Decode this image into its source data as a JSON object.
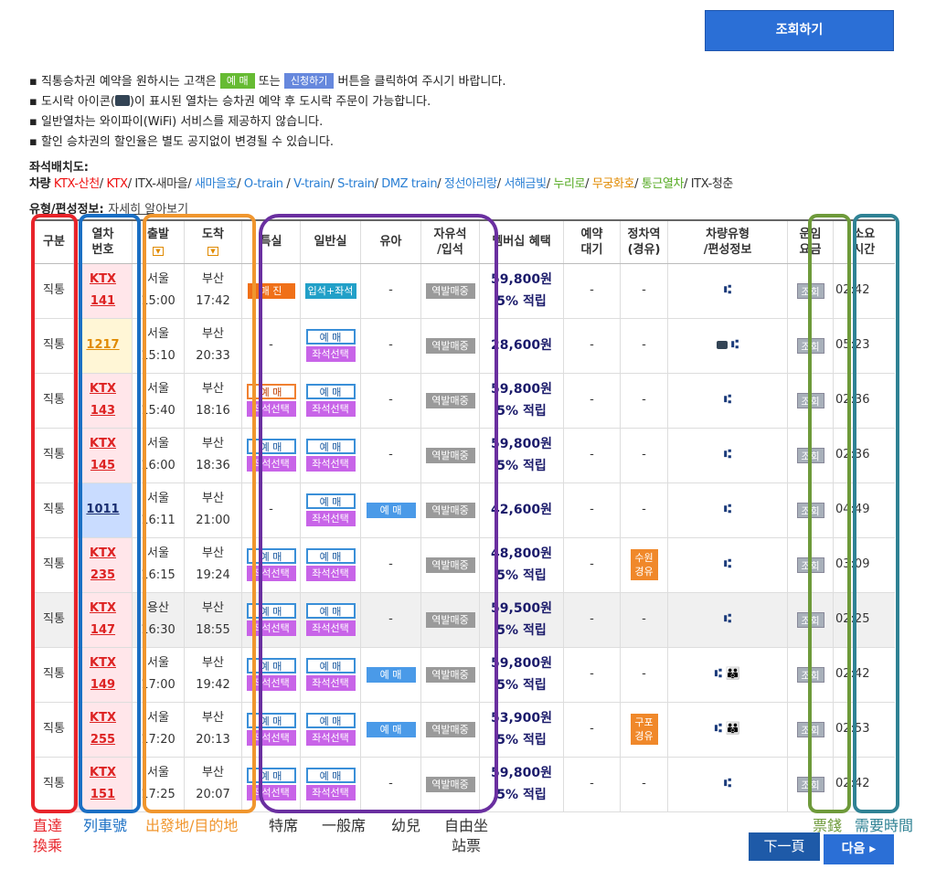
{
  "search_button": "조회하기",
  "notices": {
    "n1_a": "직통승차권 예약을 원하시는 고객은",
    "n1_chip1": "예 매",
    "n1_b": "또는",
    "n1_chip2": "신청하기",
    "n1_c": "버튼을 클릭하여 주시기 바랍니다.",
    "n2_a": "도시락 아이콘(",
    "n2_b": ")이 표시된 열차는 승차권 예약 후 도시락 주문이 가능합니다.",
    "n3": "일반열차는 와이파이(WiFi) 서비스를 제공하지 않습니다.",
    "n4": "할인 승차권의 할인율은 별도 공지없이 변경될 수 있습니다."
  },
  "seat_layout_label": "좌석배치도:",
  "vehicle_label": "차량",
  "types": [
    "KTX-산천",
    "KTX",
    "ITX-새마을",
    "새마을호",
    "O-train",
    "V-train",
    "S-train",
    "DMZ train",
    "정선아리랑",
    "서해금빛",
    "누리로",
    "무궁화호",
    "통근열차",
    "ITX-청춘"
  ],
  "composition_label": "유형/편성정보:",
  "composition_link": "자세히 알아보기",
  "headers": {
    "type": "구분",
    "train_no": "열차\n번호",
    "dep": "출발",
    "arr": "도착",
    "special": "특실",
    "general": "일반실",
    "infant": "유아",
    "free": "자유석\n/입석",
    "member": "멤버십 혜택",
    "wait": "예약\n대기",
    "stops": "정차역\n(경유)",
    "car": "차량유형\n/편성정보",
    "fare": "운임\n요금",
    "duration": "소요\n시간"
  },
  "labels": {
    "reserve": "예 매",
    "seat_select": "좌석선택",
    "sold_out": "매 진",
    "standing_seat": "입석+좌석",
    "station_sale": "역발매중",
    "lookup": "조회",
    "points": "5% 적립",
    "dash": "-"
  },
  "rows": [
    {
      "type": "직통",
      "brand": "KTX",
      "no": "141",
      "dep": "서울",
      "dep_t": "15:00",
      "arr": "부산",
      "arr_t": "17:42",
      "special": "sold",
      "general": "standseat",
      "infant": "-",
      "price": "59,800원",
      "pts": true,
      "via": "",
      "icons": "seat",
      "dur": "02:42",
      "bg": "pink"
    },
    {
      "type": "직통",
      "brand": "",
      "no": "1217",
      "dep": "서울",
      "dep_t": "15:10",
      "arr": "부산",
      "arr_t": "20:33",
      "special": "-",
      "general": "res",
      "infant": "-",
      "price": "28,600원",
      "pts": false,
      "via": "",
      "icons": "lunch",
      "dur": "05:23",
      "bg": "yellow"
    },
    {
      "type": "직통",
      "brand": "KTX",
      "no": "143",
      "dep": "서울",
      "dep_t": "15:40",
      "arr": "부산",
      "arr_t": "18:16",
      "special": "reso",
      "general": "res",
      "infant": "-",
      "price": "59,800원",
      "pts": true,
      "via": "",
      "icons": "seat",
      "dur": "02:36",
      "bg": "pink"
    },
    {
      "type": "직통",
      "brand": "KTX",
      "no": "145",
      "dep": "서울",
      "dep_t": "16:00",
      "arr": "부산",
      "arr_t": "18:36",
      "special": "res",
      "general": "res",
      "infant": "-",
      "price": "59,800원",
      "pts": true,
      "via": "",
      "icons": "seat",
      "dur": "02:36",
      "bg": "pink"
    },
    {
      "type": "직통",
      "brand": "",
      "no": "1011",
      "dep": "서울",
      "dep_t": "16:11",
      "arr": "부산",
      "arr_t": "21:00",
      "special": "-",
      "general": "res",
      "infant": "baby",
      "price": "42,600원",
      "pts": false,
      "via": "",
      "icons": "seat",
      "dur": "04:49",
      "bg": "blue"
    },
    {
      "type": "직통",
      "brand": "KTX",
      "no": "235",
      "dep": "서울",
      "dep_t": "16:15",
      "arr": "부산",
      "arr_t": "19:24",
      "special": "res",
      "general": "res",
      "infant": "-",
      "price": "48,800원",
      "pts": true,
      "via": "수원\n경유",
      "icons": "seat",
      "dur": "03:09",
      "bg": "pink"
    },
    {
      "type": "직통",
      "brand": "KTX",
      "no": "147",
      "dep": "용산",
      "dep_t": "16:30",
      "arr": "부산",
      "arr_t": "18:55",
      "special": "res",
      "general": "res",
      "infant": "-",
      "price": "59,500원",
      "pts": true,
      "via": "",
      "icons": "seat",
      "dur": "02:25",
      "bg": "pink",
      "shade": true
    },
    {
      "type": "직통",
      "brand": "KTX",
      "no": "149",
      "dep": "서울",
      "dep_t": "17:00",
      "arr": "부산",
      "arr_t": "19:42",
      "special": "res",
      "general": "res",
      "infant": "baby",
      "price": "59,800원",
      "pts": true,
      "via": "",
      "icons": "family",
      "dur": "02:42",
      "bg": "pink"
    },
    {
      "type": "직통",
      "brand": "KTX",
      "no": "255",
      "dep": "서울",
      "dep_t": "17:20",
      "arr": "부산",
      "arr_t": "20:13",
      "special": "res",
      "general": "res",
      "infant": "baby",
      "price": "53,900원",
      "pts": true,
      "via": "구포\n경유",
      "icons": "family",
      "dur": "02:53",
      "bg": "pink"
    },
    {
      "type": "직통",
      "brand": "KTX",
      "no": "151",
      "dep": "서울",
      "dep_t": "17:25",
      "arr": "부산",
      "arr_t": "20:07",
      "special": "res",
      "general": "res",
      "infant": "-",
      "price": "59,800원",
      "pts": true,
      "via": "",
      "icons": "seat",
      "dur": "02:42",
      "bg": "pink"
    }
  ],
  "annotations": {
    "type": "直達\n換乘",
    "train_no": "列車號",
    "depart_arrive": "出發地/目的地",
    "special": "特席",
    "general": "一般席",
    "infant": "幼兒",
    "free": "自由坐\n站票",
    "fare": "票錢",
    "duration": "需要時間"
  },
  "next_page_annot": "下一頁",
  "next_button": "다음 ▸",
  "colors": {
    "red": "#e8242a",
    "blue": "#1a6fc4",
    "orange": "#f0962e",
    "purple": "#6a2fa0",
    "green": "#6e9a3a",
    "teal": "#2f8294"
  }
}
